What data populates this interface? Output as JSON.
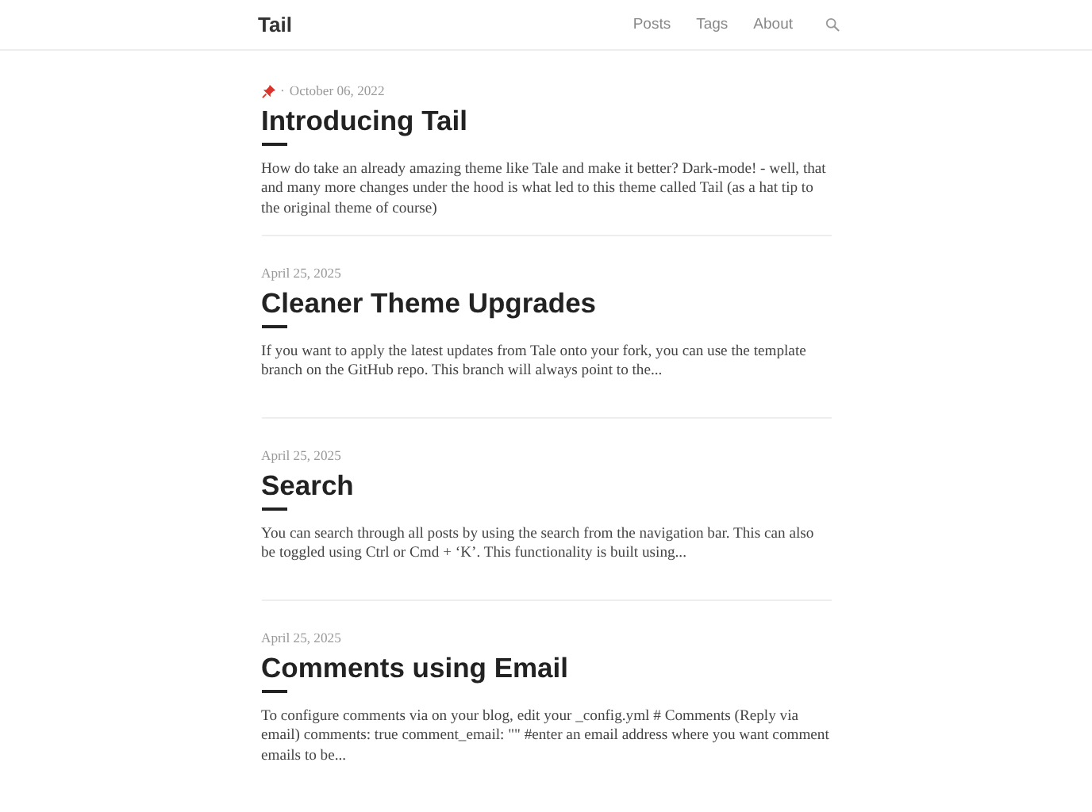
{
  "header": {
    "site_title": "Tail",
    "nav": [
      {
        "label": "Posts"
      },
      {
        "label": "Tags"
      },
      {
        "label": "About"
      }
    ]
  },
  "posts": [
    {
      "pinned": true,
      "separator": "·",
      "date": "October 06, 2022",
      "title": "Introducing Tail",
      "excerpt": "How do take an already amazing theme like Tale and make it better? Dark-mode! - well, that and many more changes under the hood is what led to this theme called Tail (as a hat tip to the original theme of course)"
    },
    {
      "pinned": false,
      "date": "April 25, 2025",
      "title": "Cleaner Theme Upgrades",
      "excerpt": "If you want to apply the latest updates from Tale onto your fork, you can use the template branch on the GitHub repo. This branch will always point to the..."
    },
    {
      "pinned": false,
      "date": "April 25, 2025",
      "title": "Search",
      "excerpt": "You can search through all posts by using the search from the navigation bar. This can also be toggled using Ctrl or Cmd + ‘K’. This functionality is built using..."
    },
    {
      "pinned": false,
      "date": "April 25, 2025",
      "title": "Comments using Email",
      "excerpt": "To configure comments via on your blog, edit your _config.yml # Comments (Reply via email) comments: true comment_email: \"\" #enter an email address where you want comment emails to be..."
    }
  ]
}
